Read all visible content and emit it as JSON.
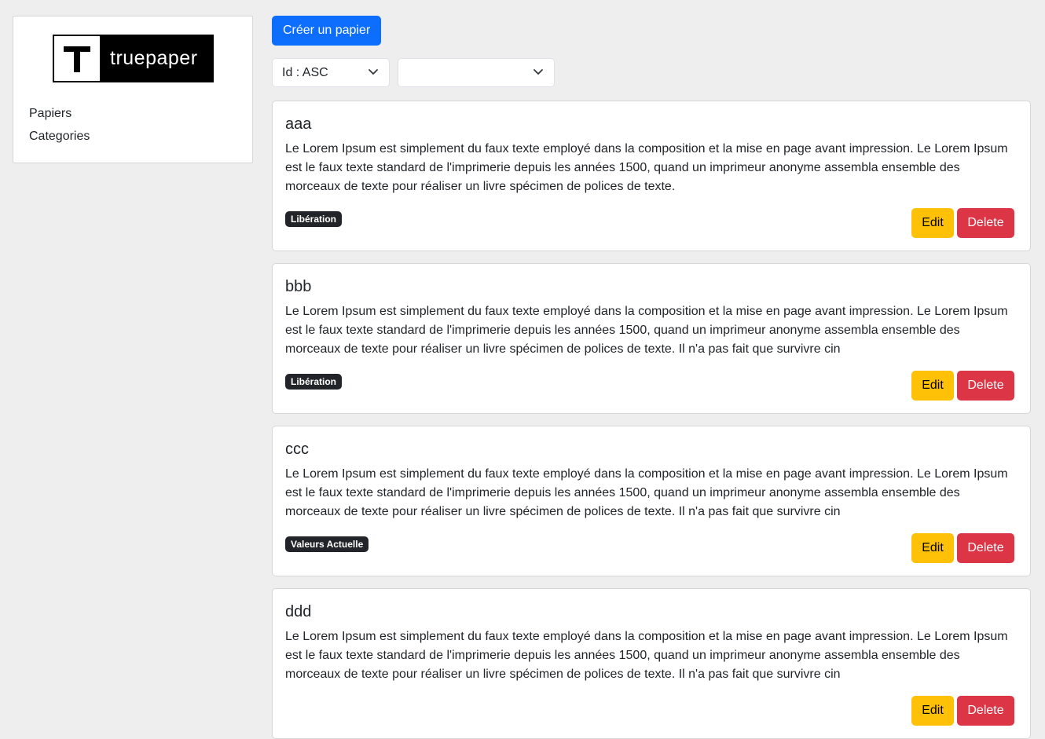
{
  "sidebar": {
    "logo": {
      "letter": "T",
      "text": "truepaper"
    },
    "items": [
      {
        "label": "Papiers"
      },
      {
        "label": "Categories"
      }
    ]
  },
  "toolbar": {
    "create_label": "Créer un papier",
    "sort_select": "Id : ASC",
    "category_select": ""
  },
  "colors": {
    "primary": "#0d6efd",
    "warning": "#ffc107",
    "danger": "#dc3545",
    "badge": "#212529"
  },
  "papers": [
    {
      "title": "aaa",
      "text": "Le Lorem Ipsum est simplement du faux texte employé dans la composition et la mise en page avant impression. Le Lorem Ipsum est le faux texte standard de l'imprimerie depuis les années 1500, quand un imprimeur anonyme assembla ensemble des morceaux de texte pour réaliser un livre spécimen de polices de texte.",
      "category": "Libération",
      "edit_label": "Edit",
      "delete_label": "Delete"
    },
    {
      "title": "bbb",
      "text": "Le Lorem Ipsum est simplement du faux texte employé dans la composition et la mise en page avant impression. Le Lorem Ipsum est le faux texte standard de l'imprimerie depuis les années 1500, quand un imprimeur anonyme assembla ensemble des morceaux de texte pour réaliser un livre spécimen de polices de texte. Il n'a pas fait que survivre cin",
      "category": "Libération",
      "edit_label": "Edit",
      "delete_label": "Delete"
    },
    {
      "title": "ccc",
      "text": "Le Lorem Ipsum est simplement du faux texte employé dans la composition et la mise en page avant impression. Le Lorem Ipsum est le faux texte standard de l'imprimerie depuis les années 1500, quand un imprimeur anonyme assembla ensemble des morceaux de texte pour réaliser un livre spécimen de polices de texte. Il n'a pas fait que survivre cin",
      "category": "Valeurs Actuelle",
      "edit_label": "Edit",
      "delete_label": "Delete"
    },
    {
      "title": "ddd",
      "text": "Le Lorem Ipsum est simplement du faux texte employé dans la composition et la mise en page avant impression. Le Lorem Ipsum est le faux texte standard de l'imprimerie depuis les années 1500, quand un imprimeur anonyme assembla ensemble des morceaux de texte pour réaliser un livre spécimen de polices de texte. Il n'a pas fait que survivre cin",
      "category": "",
      "edit_label": "Edit",
      "delete_label": "Delete"
    }
  ]
}
